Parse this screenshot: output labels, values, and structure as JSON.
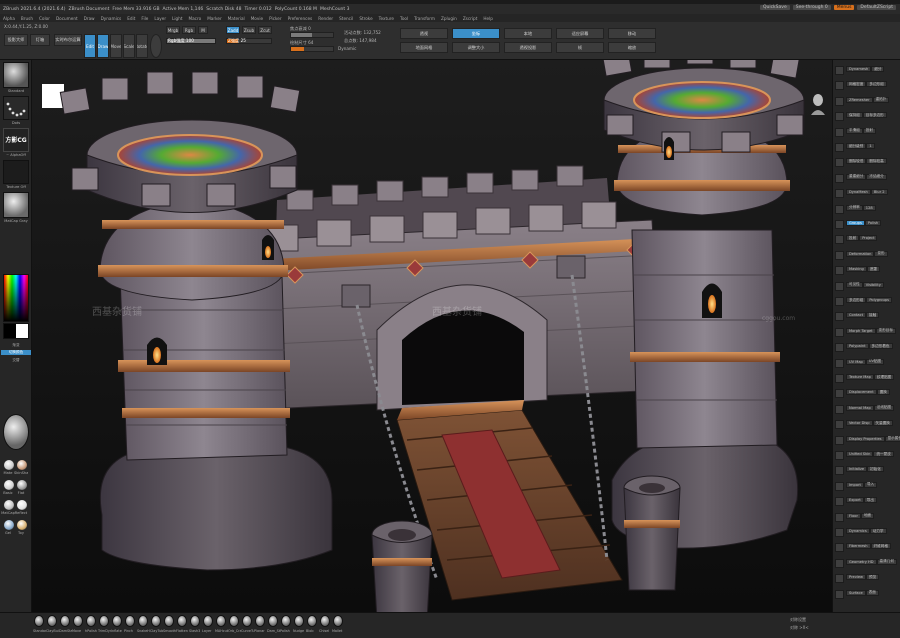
{
  "menubar": {
    "items": [
      "ZBrush 2021.6.4 (2021.6.4)",
      "ZBrush Document",
      "Free Mem 33.916 GB",
      "Active Mem 1,146",
      "Scratch Disk 48",
      "Timer 0.012",
      "PolyCount 0.168 M",
      "MeshCount 3"
    ],
    "quicksave": "QuickSave",
    "seethrough": "See-through 0",
    "menus": "Menus",
    "default": "DefaultZScript"
  },
  "menurow": {
    "items": [
      "Alpha",
      "Brush",
      "Color",
      "Document",
      "Draw",
      "Dynamics",
      "Edit",
      "File",
      "Layer",
      "Light",
      "Macro",
      "Marker",
      "Material",
      "Movie",
      "Picker",
      "Preferences",
      "Render",
      "Stencil",
      "Stroke",
      "Texture",
      "Tool",
      "Transform",
      "Zplugin",
      "Zscript",
      "Help"
    ]
  },
  "shelf": {
    "coords": "X:0.44,Y:1.25, Z:0.00",
    "projection_master": "投影大师",
    "lightbox": "灯箱",
    "live_boolean": "实时布尔运算",
    "edit": "Edit",
    "draw": "Draw",
    "move": "Move",
    "scale": "Scale",
    "rotate": "Rotate",
    "mrgb": "Mrgb",
    "rgb": "Rgb",
    "m": "M",
    "zadd": "Zadd",
    "zsub": "Zsub",
    "zcut": "Zcut",
    "rgb_intensity": "Rgb强度 100",
    "z_intensity": "Z强度 25",
    "focal_shift": "焦点衰减 0",
    "draw_size": "绘制尺寸 64",
    "dynamic": "Dynamic",
    "active_points": "活动点数: 132,752",
    "total_points": "总点数: 147,984",
    "buttons": [
      "透视",
      "地面网格",
      "坐标",
      "调整大小",
      "本地",
      "透视投影",
      "适应屏幕",
      "帧",
      "移动",
      "缩放"
    ]
  },
  "left": {
    "brush_label": "Standard",
    "stroke_label": "Dots",
    "alpha_label": "~ AlphaOff",
    "texture_label": "Texture Off",
    "material_label": "MatCap Gray",
    "logo_text": "方影CG",
    "gradient": "渐变",
    "switch_color": "切换颜色",
    "alternate": "交替",
    "materials": [
      "Mate",
      "SkinShade",
      "Basic",
      "Flat",
      "MatCap",
      "Reflect",
      "Gel",
      "Toy"
    ]
  },
  "watermarks": [
    "西基杂货铺",
    "西基杂货铺",
    "cggou.com"
  ],
  "right": {
    "items": [
      {
        "label": "Dynamesh",
        "btn": "细分"
      },
      {
        "label": "网格密度",
        "btn": "多边形组"
      },
      {
        "label": "ZRemesher",
        "btn": "重拓扑"
      },
      {
        "label": "保持组",
        "btn": "目标多边形"
      },
      {
        "label": "平滑组",
        "btn": "投射"
      },
      {
        "label": "细分级别",
        "btn": "1"
      },
      {
        "label": "删除较低",
        "btn": "删除较高"
      },
      {
        "label": "重建细分",
        "btn": "冻结细分"
      },
      {
        "label": "DynaMesh",
        "btn": "Blur 2"
      },
      {
        "label": "分辨率",
        "btn": "128"
      },
      {
        "label": "Groups",
        "btn": "Polish"
      },
      {
        "label": "投射",
        "btn": "Project"
      },
      {
        "label": "Deformation",
        "btn": "变形"
      },
      {
        "label": "Masking",
        "btn": "遮罩"
      },
      {
        "label": "可见性",
        "btn": "Visibility"
      },
      {
        "label": "多边形组",
        "btn": "Polygroups"
      },
      {
        "label": "Contact",
        "btn": "接触"
      },
      {
        "label": "Morph Target",
        "btn": "变形目标"
      },
      {
        "label": "Polypaint",
        "btn": "多边形着色"
      },
      {
        "label": "UV Map",
        "btn": "UV贴图"
      },
      {
        "label": "Texture Map",
        "btn": "纹理贴图"
      },
      {
        "label": "Displacement",
        "btn": "置换"
      },
      {
        "label": "Normal Map",
        "btn": "法线贴图"
      },
      {
        "label": "Vector Disp",
        "btn": "矢量置换"
      },
      {
        "label": "Display Properties",
        "btn": "显示属性"
      },
      {
        "label": "Unified Skin",
        "btn": "统一蒙皮"
      },
      {
        "label": "Initialize",
        "btn": "初始化"
      },
      {
        "label": "Import",
        "btn": "导入"
      },
      {
        "label": "Export",
        "btn": "导出"
      },
      {
        "label": "Floor",
        "btn": "地面"
      },
      {
        "label": "Dynamics",
        "btn": "动力学"
      },
      {
        "label": "Fibermesh",
        "btn": "纤维网格"
      },
      {
        "label": "Geometry HD",
        "btn": "高清几何"
      },
      {
        "label": "Preview",
        "btn": "预览"
      },
      {
        "label": "Surface",
        "btn": "表面"
      }
    ]
  },
  "bottom": {
    "brushes": [
      "Standard",
      "ClayBuildup",
      "DamStandard",
      "Move",
      "hPolish",
      "TrimDynamic",
      "Inflate",
      "Pinch",
      "SnakeHook",
      "ClayTubes",
      "Smooth",
      "Flatten",
      "Slash3",
      "Layer",
      "MAHcut",
      "Orb_Cracks",
      "CurveTube",
      "Planar",
      "Dam_Standard",
      "Polish",
      "Nudge",
      "Blob",
      "Chisel",
      "Mallet"
    ],
    "right1": "对称设置",
    "right2": "对称 >X<"
  }
}
